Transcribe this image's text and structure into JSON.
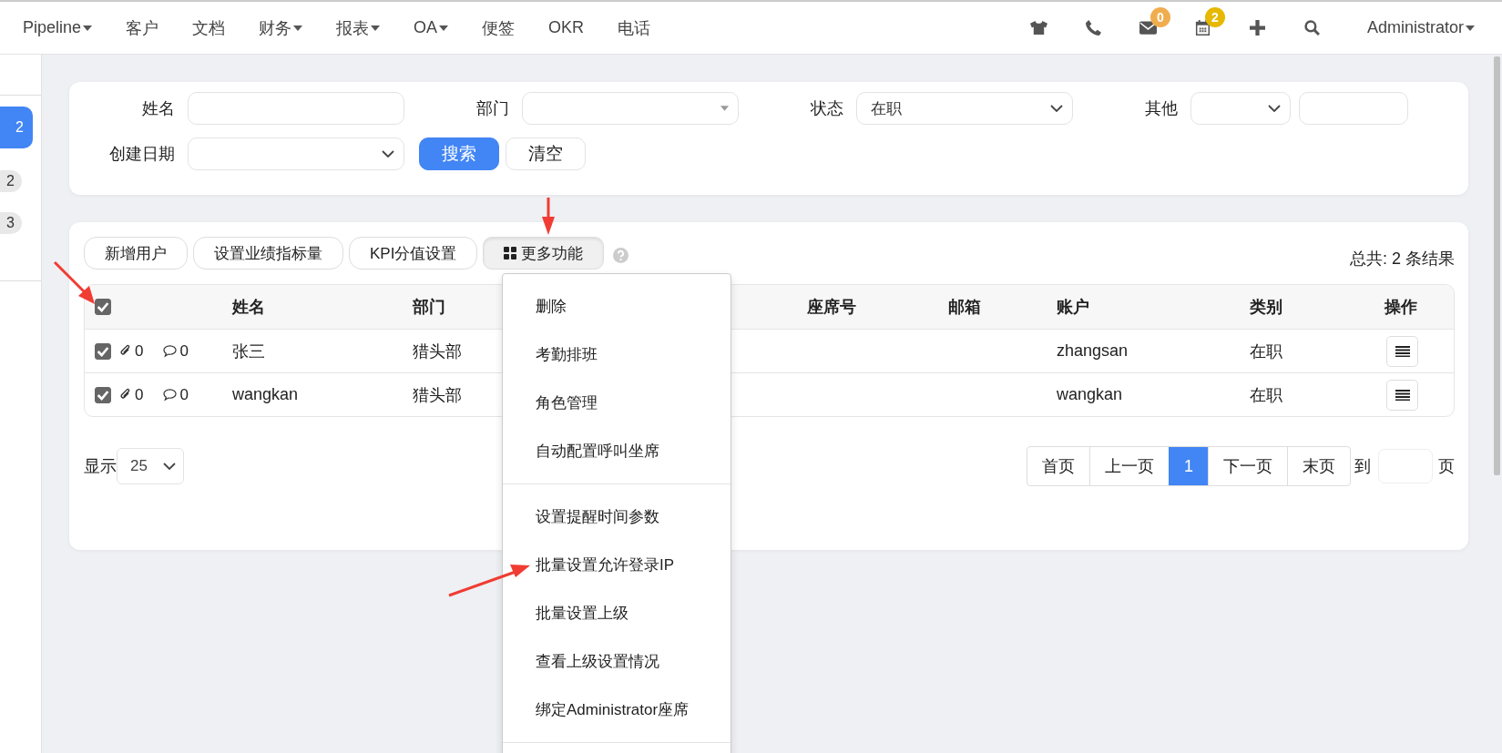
{
  "top_nav": {
    "items": [
      {
        "label": "Pipeline",
        "dropdown": true
      },
      {
        "label": "客户",
        "dropdown": false
      },
      {
        "label": "文档",
        "dropdown": false
      },
      {
        "label": "财务",
        "dropdown": true
      },
      {
        "label": "报表",
        "dropdown": true
      },
      {
        "label": "OA",
        "dropdown": true
      },
      {
        "label": "便签",
        "dropdown": false
      },
      {
        "label": "OKR",
        "dropdown": false
      },
      {
        "label": "电话",
        "dropdown": false
      }
    ],
    "toolbar": [
      {
        "kind": "shirt"
      },
      {
        "kind": "phone"
      },
      {
        "kind": "mail",
        "badge": "0",
        "color": "#f0ad4e"
      },
      {
        "kind": "calendar",
        "badge": "2",
        "color": "#e6b800"
      },
      {
        "kind": "plus"
      },
      {
        "kind": "search"
      }
    ],
    "user": {
      "label": "Administrator",
      "dropdown": true
    }
  },
  "sidebar": {
    "items": [
      {
        "label": "2",
        "selected": true
      },
      {
        "label": "2",
        "selected": false
      },
      {
        "label": "3",
        "selected": false
      }
    ]
  },
  "filters": {
    "rows": [
      {
        "fields": [
          {
            "label": "姓名",
            "kind": "text"
          },
          {
            "label": "部门",
            "kind": "combo"
          },
          {
            "label": "状态",
            "kind": "select",
            "value": "在职"
          },
          {
            "label": "其他",
            "kind": "select-text"
          }
        ]
      },
      {
        "fields": [
          {
            "label": "创建日期",
            "kind": "select"
          }
        ]
      }
    ],
    "buttons": [
      {
        "label": "搜索",
        "primary": true
      },
      {
        "label": "清空",
        "primary": false
      }
    ]
  },
  "actions": [
    {
      "label": "新增用户",
      "kind": "button"
    },
    {
      "label": "设置业绩指标量",
      "kind": "button"
    },
    {
      "label": "KPI分值设置",
      "kind": "button"
    },
    {
      "label": "更多功能",
      "kind": "menu",
      "expanded": true
    }
  ],
  "total": "总共: 2 条结果",
  "table": {
    "select_all": true,
    "columns": [
      "姓名",
      "部门",
      "座席号",
      "邮箱",
      "账户",
      "类别",
      "操作"
    ],
    "rows": [
      {
        "checked": true,
        "attachments": "0",
        "comments": "0",
        "name": "张三",
        "department": "猎头部",
        "account": "zhangsan",
        "category": "在职"
      },
      {
        "checked": true,
        "attachments": "0",
        "comments": "0",
        "name": "wangkan",
        "department": "猎头部",
        "account": "wangkan",
        "category": "在职"
      }
    ]
  },
  "page_size": {
    "label": "显示",
    "value": "25"
  },
  "pager": {
    "pages": [
      {
        "label": "首页",
        "selected": false
      },
      {
        "label": "上一页",
        "selected": false
      },
      {
        "label": "1",
        "selected": true
      },
      {
        "label": "下一页",
        "selected": false
      },
      {
        "label": "末页",
        "selected": false
      }
    ],
    "goto_label": "到",
    "goto_suffix": "页"
  },
  "more_menu": {
    "groups": [
      {
        "items": [
          "删除",
          "考勤排班",
          "角色管理",
          "自动配置呼叫坐席"
        ]
      },
      {
        "items": [
          "设置提醒时间参数",
          "批量设置允许登录IP",
          "批量设置上级",
          "查看上级设置情况",
          "绑定Administrator座席"
        ]
      }
    ]
  }
}
